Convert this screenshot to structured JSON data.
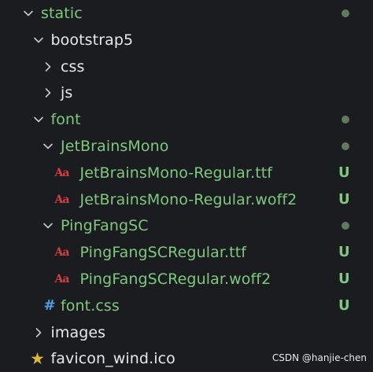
{
  "colors": {
    "background": "#1b1c1f",
    "text_default": "#e8e8e8",
    "text_untracked": "#7fc97f",
    "dot": "#5f7a5f",
    "badge": "#7fc97f",
    "chevron": "#c8c8c8",
    "font_icon": "#d64040",
    "css_icon": "#4d9fe0",
    "star_icon": "#d9b93a"
  },
  "explorer": {
    "items": [
      {
        "label": "static",
        "type": "folder",
        "expanded": true,
        "depth": 0,
        "status": "dot"
      },
      {
        "label": "bootstrap5",
        "type": "folder",
        "expanded": true,
        "depth": 1,
        "status": ""
      },
      {
        "label": "css",
        "type": "folder",
        "expanded": false,
        "depth": 2,
        "status": ""
      },
      {
        "label": "js",
        "type": "folder",
        "expanded": false,
        "depth": 2,
        "status": ""
      },
      {
        "label": "font",
        "type": "folder",
        "expanded": true,
        "depth": 1,
        "status": "dot"
      },
      {
        "label": "JetBrainsMono",
        "type": "folder",
        "expanded": true,
        "depth": 2,
        "status": "dot"
      },
      {
        "label": "JetBrainsMono-Regular.ttf",
        "type": "font-file",
        "icon": "font-file-icon",
        "depth": 3,
        "status": "U"
      },
      {
        "label": "JetBrainsMono-Regular.woff2",
        "type": "font-file",
        "icon": "font-file-icon",
        "depth": 3,
        "status": "U"
      },
      {
        "label": "PingFangSC",
        "type": "folder",
        "expanded": true,
        "depth": 2,
        "status": "dot"
      },
      {
        "label": "PingFangSCRegular.ttf",
        "type": "font-file",
        "icon": "font-file-icon",
        "depth": 3,
        "status": "U"
      },
      {
        "label": "PingFangSCRegular.woff2",
        "type": "font-file",
        "icon": "font-file-icon",
        "depth": 3,
        "status": "U"
      },
      {
        "label": "font.css",
        "type": "css-file",
        "icon": "hash-icon",
        "depth": 2,
        "status": "U"
      },
      {
        "label": "images",
        "type": "folder",
        "expanded": false,
        "depth": 1,
        "status": ""
      },
      {
        "label": "favicon_wind.ico",
        "type": "ico-file",
        "icon": "star-icon",
        "depth": 1,
        "status": ""
      }
    ],
    "font_icon_glyph": "Aa",
    "css_icon_glyph": "#",
    "star_icon_glyph": "★"
  },
  "watermark": "CSDN @hanjie-chen"
}
